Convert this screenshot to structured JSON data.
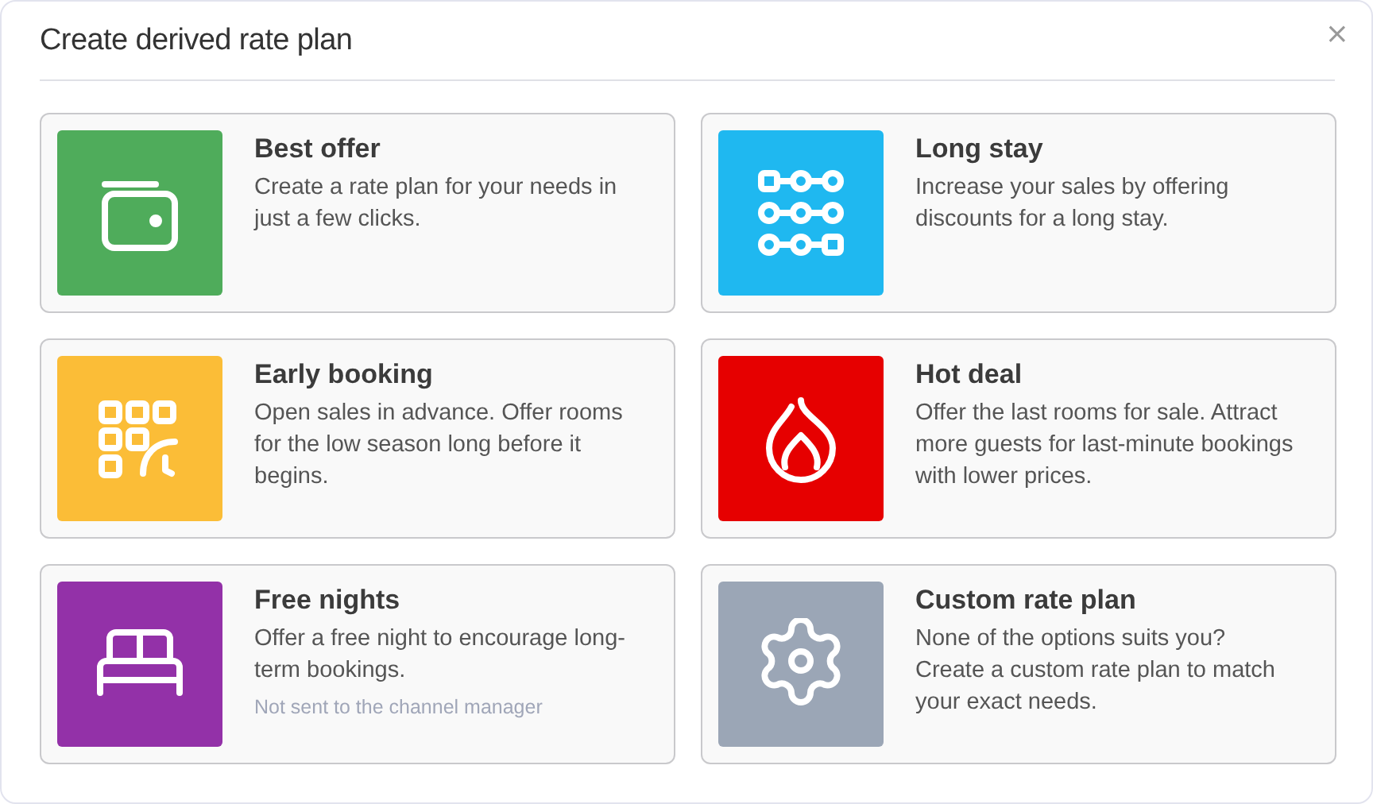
{
  "dialog": {
    "title": "Create derived rate plan",
    "close": "×"
  },
  "options": [
    {
      "kind": "wallet",
      "color": "#4fac5b",
      "title": "Best offer",
      "description": "Create a rate plan for your needs in just a few clicks."
    },
    {
      "kind": "nodes",
      "color": "#1fb8f0",
      "title": "Long stay",
      "description": "Increase your sales by offering discounts for a long stay."
    },
    {
      "kind": "calendar",
      "color": "#fbbd37",
      "title": "Early booking",
      "description": "Open sales in advance. Offer rooms for the low season long before it begins."
    },
    {
      "kind": "flame",
      "color": "#e60000",
      "title": "Hot deal",
      "description": "Offer the last rooms for sale. Attract more guests for last-minute bookings with lower prices."
    },
    {
      "kind": "bed",
      "color": "#9331a8",
      "title": "Free nights",
      "description": "Offer a free night to encourage long-term bookings.",
      "note": "Not sent to the channel manager"
    },
    {
      "kind": "gear",
      "color": "#9ba6b6",
      "title": "Custom rate plan",
      "description": "None of the options suits you? Create a custom rate plan to match your exact needs."
    }
  ]
}
